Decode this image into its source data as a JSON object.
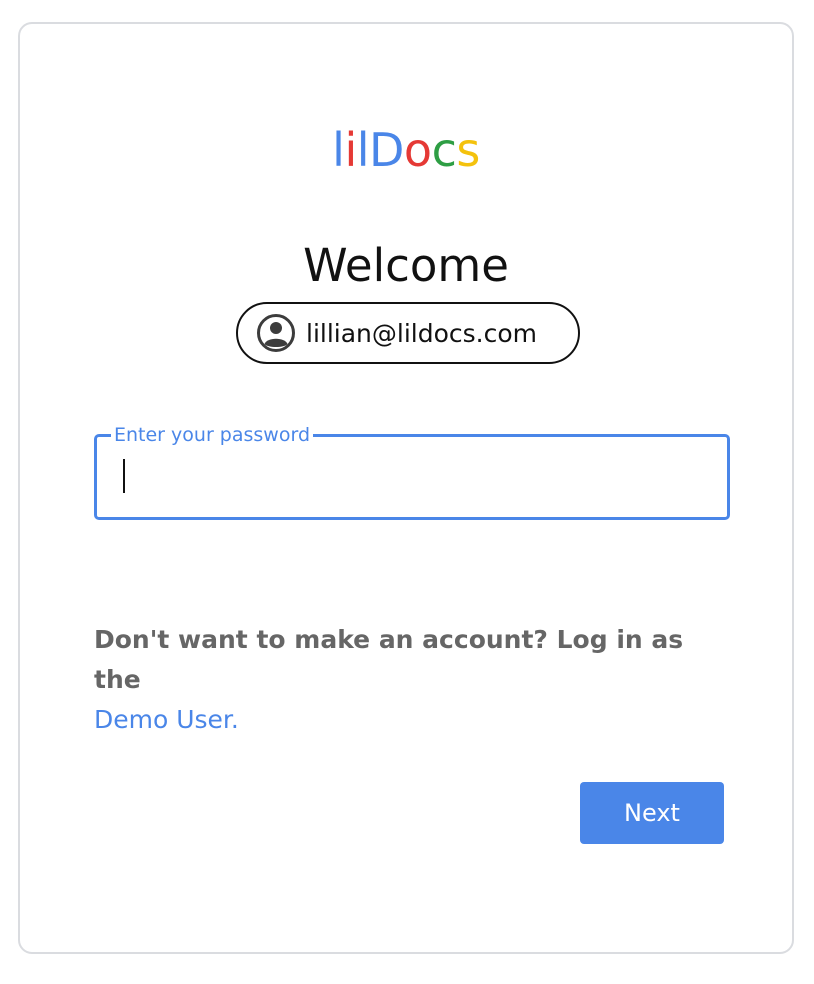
{
  "logo": {
    "letters": [
      {
        "char": "l",
        "color": "#4a86e8"
      },
      {
        "char": "i",
        "color": "#e53935"
      },
      {
        "char": "l",
        "color": "#4a86e8"
      },
      {
        "char": "D",
        "color": "#4a86e8"
      },
      {
        "char": "o",
        "color": "#e53935"
      },
      {
        "char": "c",
        "color": "#2e9e44"
      },
      {
        "char": "s",
        "color": "#f4c20d"
      }
    ]
  },
  "heading": "Welcome",
  "account": {
    "email": "lillian@lildocs.com",
    "icon": "user-circle-icon"
  },
  "password": {
    "label": "Enter your password",
    "value": ""
  },
  "demo": {
    "prompt": "Don't want to make an account? Log in as the",
    "link_label": "Demo User."
  },
  "actions": {
    "next_label": "Next"
  },
  "colors": {
    "accent": "#4a86e8",
    "text_muted": "#666666",
    "border": "#dadce0"
  }
}
